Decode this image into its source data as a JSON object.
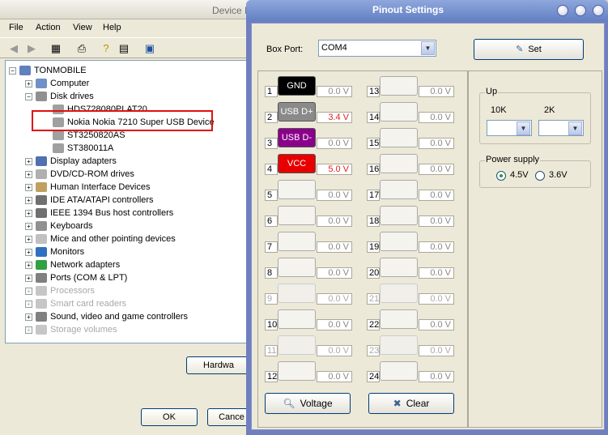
{
  "device_manager": {
    "title": "Device M",
    "menu": [
      "File",
      "Action",
      "View",
      "Help"
    ],
    "tree_root": "TONMOBILE",
    "tree": [
      {
        "label": "Computer",
        "faded": false
      },
      {
        "label": "Disk drives",
        "faded": false
      },
      {
        "label": "HDS728080PLAT20",
        "faded": false
      },
      {
        "label": "Nokia Nokia 7210 Super USB Device",
        "faded": false
      },
      {
        "label": "ST3250820AS",
        "faded": false
      },
      {
        "label": "ST380011A",
        "faded": false
      },
      {
        "label": "Display adapters",
        "faded": false
      },
      {
        "label": "DVD/CD-ROM drives",
        "faded": false
      },
      {
        "label": "Human Interface Devices",
        "faded": false
      },
      {
        "label": "IDE ATA/ATAPI controllers",
        "faded": false
      },
      {
        "label": "IEEE 1394 Bus host controllers",
        "faded": false
      },
      {
        "label": "Keyboards",
        "faded": false
      },
      {
        "label": "Mice and other pointing devices",
        "faded": false
      },
      {
        "label": "Monitors",
        "faded": false
      },
      {
        "label": "Network adapters",
        "faded": false
      },
      {
        "label": "Ports (COM & LPT)",
        "faded": false
      },
      {
        "label": "Processors",
        "faded": true
      },
      {
        "label": "Smart card readers",
        "faded": true
      },
      {
        "label": "Sound, video and game controllers",
        "faded": true
      },
      {
        "label": "Storage volumes",
        "faded": true
      }
    ],
    "hardware_button": "Hardwa",
    "ok_button": "OK",
    "cancel_button": "Cance"
  },
  "pinout": {
    "title": "Pinout Settings",
    "box_port_label": "Box Port:",
    "box_port_value": "COM4",
    "set_button": "Set",
    "voltage_button": "Voltage",
    "clear_button": "Clear",
    "pins": [
      {
        "num": "1",
        "label": "GND",
        "color": "#000000",
        "voltage": "0.0 V",
        "vcolor": "#888888",
        "enabled": true
      },
      {
        "num": "2",
        "label": "USB D+",
        "color": "#8a8a8a",
        "voltage": "3.4 V",
        "vcolor": "#e02020",
        "enabled": true
      },
      {
        "num": "3",
        "label": "USB D-",
        "color": "#8a008a",
        "voltage": "0.0 V",
        "vcolor": "#888888",
        "enabled": true
      },
      {
        "num": "4",
        "label": "VCC",
        "color": "#e80000",
        "voltage": "5.0 V",
        "vcolor": "#e02020",
        "enabled": true
      },
      {
        "num": "5",
        "label": "",
        "color": "",
        "voltage": "0.0 V",
        "vcolor": "#888888",
        "enabled": true
      },
      {
        "num": "6",
        "label": "",
        "color": "",
        "voltage": "0.0 V",
        "vcolor": "#888888",
        "enabled": true
      },
      {
        "num": "7",
        "label": "",
        "color": "",
        "voltage": "0.0 V",
        "vcolor": "#888888",
        "enabled": true
      },
      {
        "num": "8",
        "label": "",
        "color": "",
        "voltage": "0.0 V",
        "vcolor": "#888888",
        "enabled": true
      },
      {
        "num": "9",
        "label": "",
        "color": "",
        "voltage": "0.0 V",
        "vcolor": "#aaaaaa",
        "enabled": false
      },
      {
        "num": "10",
        "label": "",
        "color": "",
        "voltage": "0.0 V",
        "vcolor": "#888888",
        "enabled": true
      },
      {
        "num": "11",
        "label": "",
        "color": "",
        "voltage": "0.0 V",
        "vcolor": "#aaaaaa",
        "enabled": false
      },
      {
        "num": "12",
        "label": "",
        "color": "",
        "voltage": "0.0 V",
        "vcolor": "#888888",
        "enabled": true
      },
      {
        "num": "13",
        "label": "",
        "color": "",
        "voltage": "0.0 V",
        "vcolor": "#888888",
        "enabled": true
      },
      {
        "num": "14",
        "label": "",
        "color": "",
        "voltage": "0.0 V",
        "vcolor": "#888888",
        "enabled": true
      },
      {
        "num": "15",
        "label": "",
        "color": "",
        "voltage": "0.0 V",
        "vcolor": "#888888",
        "enabled": true
      },
      {
        "num": "16",
        "label": "",
        "color": "",
        "voltage": "0.0 V",
        "vcolor": "#888888",
        "enabled": true
      },
      {
        "num": "17",
        "label": "",
        "color": "",
        "voltage": "0.0 V",
        "vcolor": "#888888",
        "enabled": true
      },
      {
        "num": "18",
        "label": "",
        "color": "",
        "voltage": "0.0 V",
        "vcolor": "#888888",
        "enabled": true
      },
      {
        "num": "19",
        "label": "",
        "color": "",
        "voltage": "0.0 V",
        "vcolor": "#888888",
        "enabled": true
      },
      {
        "num": "20",
        "label": "",
        "color": "",
        "voltage": "0.0 V",
        "vcolor": "#888888",
        "enabled": true
      },
      {
        "num": "21",
        "label": "",
        "color": "",
        "voltage": "0.0 V",
        "vcolor": "#aaaaaa",
        "enabled": false
      },
      {
        "num": "22",
        "label": "",
        "color": "",
        "voltage": "0.0 V",
        "vcolor": "#888888",
        "enabled": true
      },
      {
        "num": "23",
        "label": "",
        "color": "",
        "voltage": "0.0 V",
        "vcolor": "#aaaaaa",
        "enabled": false
      },
      {
        "num": "24",
        "label": "",
        "color": "",
        "voltage": "0.0 V",
        "vcolor": "#888888",
        "enabled": true
      }
    ],
    "up_group": {
      "legend": "Up",
      "label_10k": "10K",
      "label_2k": "2K"
    },
    "power_group": {
      "legend": "Power supply",
      "option_1": "4.5V",
      "option_2": "3.6V",
      "selected": "4.5V"
    }
  }
}
